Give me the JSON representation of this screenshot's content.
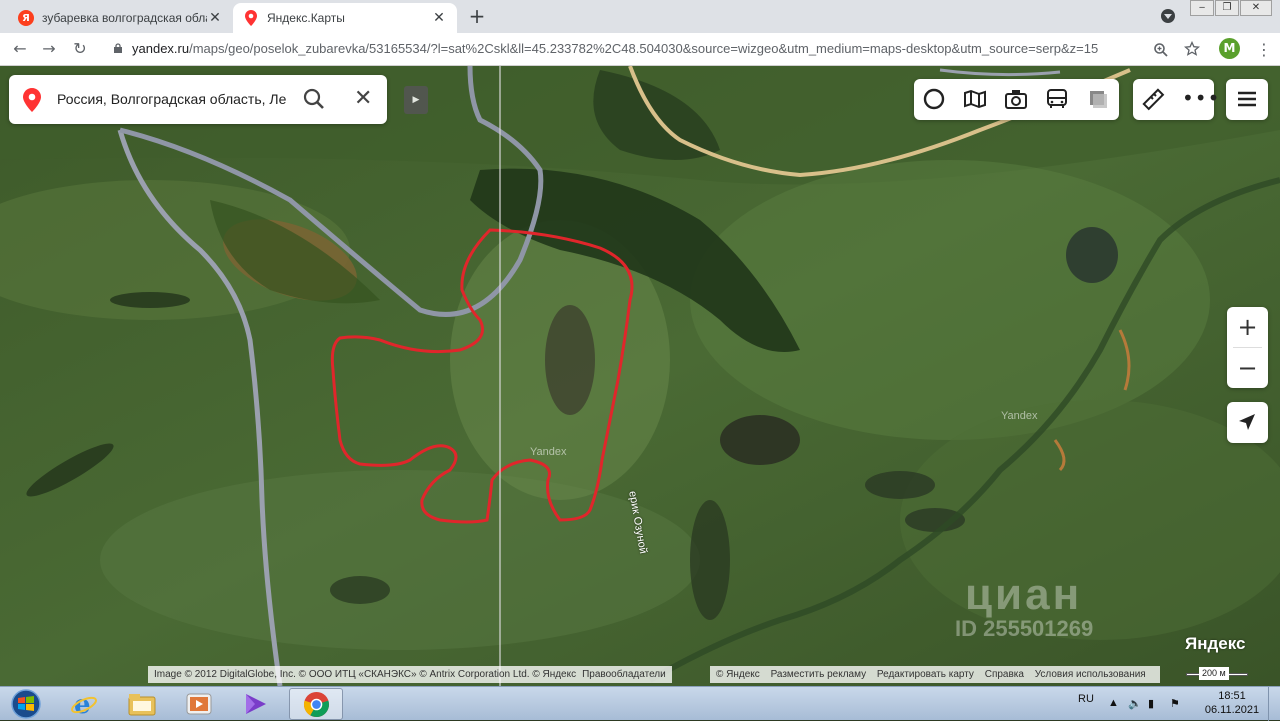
{
  "browser": {
    "tabs": [
      {
        "title": "зубаревка волгоградская облас",
        "close": "✕"
      },
      {
        "title": "Яндекс.Карты",
        "close": "✕"
      }
    ],
    "new_tab": "+",
    "url_host": "yandex.ru",
    "url_path": "/maps/geo/poselok_zubarevka/53165534/?l=sat%2Cskl&ll=45.233782%2C48.504030&source=wizgeo&utm_medium=maps-desktop&utm_source=serp&z=15",
    "profile_initial": "M"
  },
  "map": {
    "search_text": "Россия, Волгоградская область, Ле",
    "river_label": "ерик Озуной",
    "watermark_1": "Yandex",
    "watermark_2": "Yandex",
    "cian_big": "циан",
    "cian_id": "ID 255501269",
    "logo": "Яндекс",
    "zoom_in": "+",
    "zoom_out": "−",
    "copyright": "Image © 2012 DigitalGlobe, Inc. © ООО ИТЦ «СКАНЭКС» © Antrix Corporation Ltd. © Яндекс",
    "copyright_link": "Правообладатели",
    "footer_links": [
      "© Яндекс",
      "Разместить рекламу",
      "Редактировать карту",
      "Справка",
      "Условия использования"
    ],
    "scale_label": "200 м",
    "highlight_color": "#e0262b"
  },
  "taskbar": {
    "lang": "RU",
    "time": "18:51",
    "date": "06.11.2021"
  }
}
